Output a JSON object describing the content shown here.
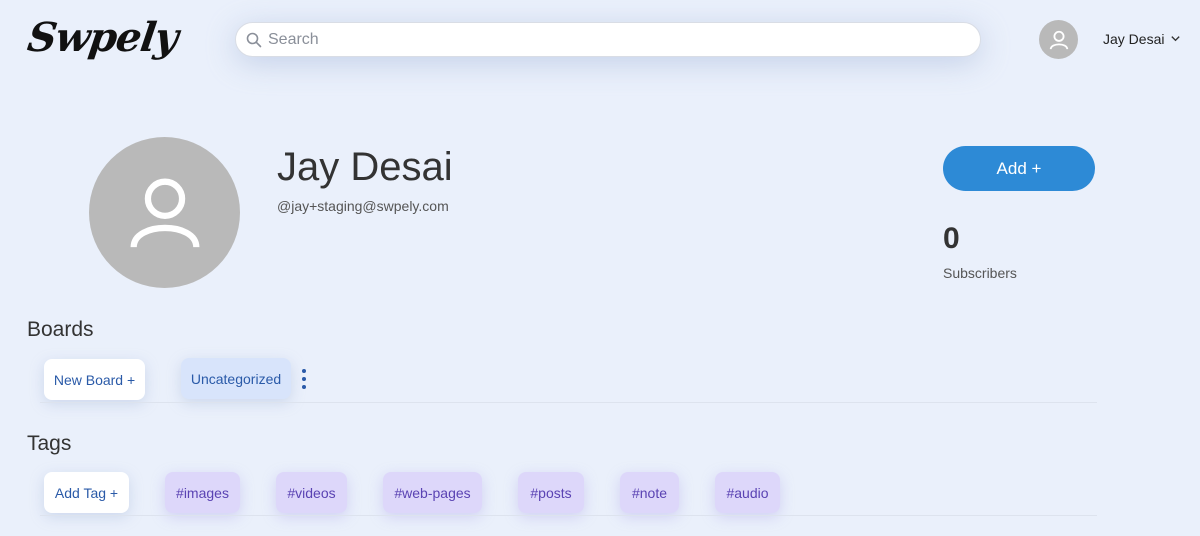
{
  "header": {
    "logo_text": "Swpely",
    "search_placeholder": "Search",
    "user_name": "Jay Desai"
  },
  "profile": {
    "name": "Jay Desai",
    "handle": "@jay+staging@swpely.com",
    "add_button_label": "Add +",
    "subscribers_count": "0",
    "subscribers_label": "Subscribers"
  },
  "boards": {
    "title": "Boards",
    "new_board_label": "New Board +",
    "items": [
      "Uncategorized"
    ]
  },
  "tags": {
    "title": "Tags",
    "add_tag_label": "Add Tag +",
    "items": [
      "#images",
      "#videos",
      "#web-pages",
      "#posts",
      "#note",
      "#audio"
    ]
  },
  "colors": {
    "background": "#eaf0fb",
    "accent": "#2d8ad6",
    "tag_bg": "#ddd7fa",
    "board_bg": "#d8e4fb"
  }
}
